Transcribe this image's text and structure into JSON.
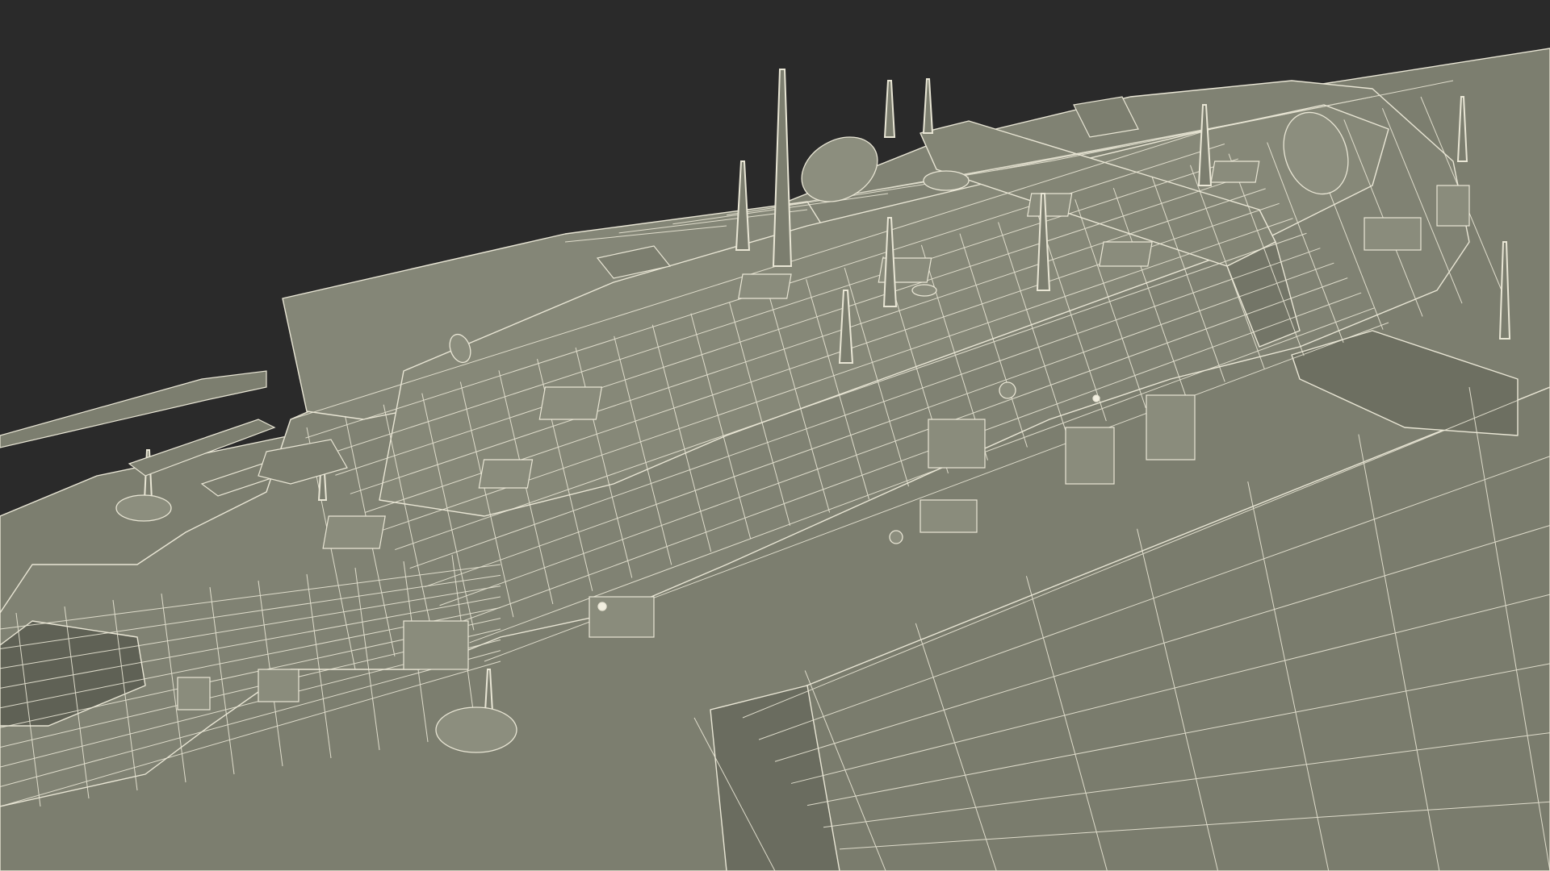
{
  "scene": {
    "background_color": "#2a2a2a",
    "model_fill": "#7c7e6f",
    "model_fill_dark": "#6a6c5f",
    "model_fill_light": "#8a8c7c",
    "wire_color": "#e9e6d5"
  }
}
